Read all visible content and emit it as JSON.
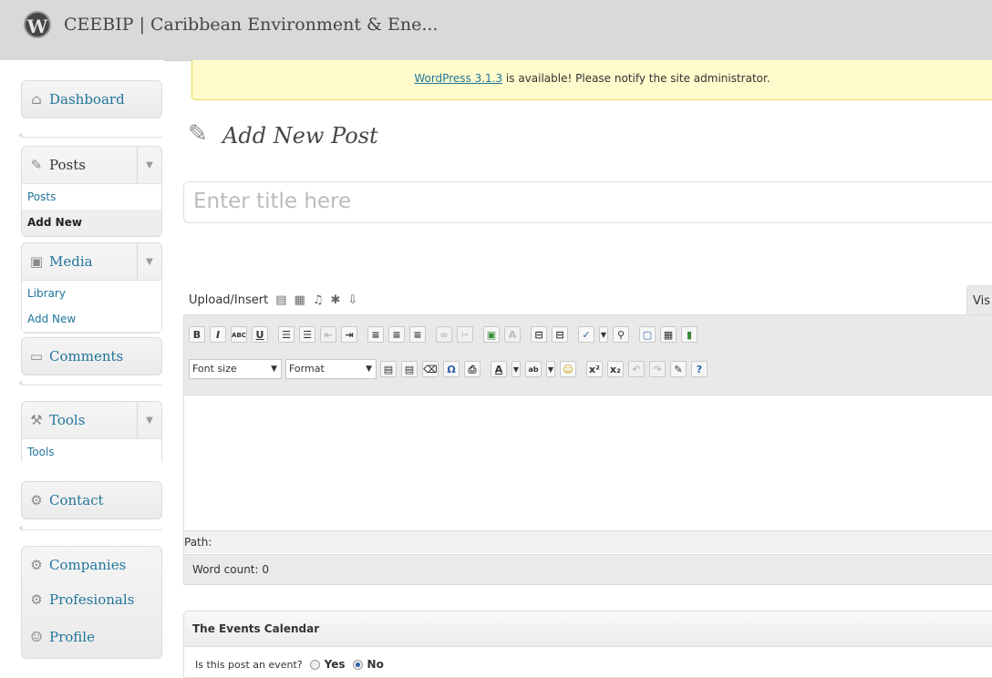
{
  "header": {
    "site_title": "CEEBIP | Caribbean Environment & Ene...",
    "logo_letter": "W"
  },
  "sidebar": {
    "dashboard": "Dashboard",
    "posts": {
      "label": "Posts",
      "items": [
        "Posts",
        "Add New"
      ]
    },
    "media": {
      "label": "Media",
      "items": [
        "Library",
        "Add New"
      ]
    },
    "comments": "Comments",
    "tools": {
      "label": "Tools",
      "items": [
        "Tools"
      ]
    },
    "contact": "Contact",
    "companies": "Companies",
    "profesionals": "Profesionals",
    "profile": "Profile"
  },
  "notice": {
    "link": "WordPress 3.1.3",
    "text": " is available! Please notify the site administrator."
  },
  "page": {
    "title": "Add New Post",
    "title_placeholder": "Enter title here"
  },
  "editor": {
    "upload_label": "Upload/Insert",
    "visual_tab": "Vis",
    "font_size": "Font size",
    "format": "Format",
    "path_label": "Path:",
    "word_count": "Word count: 0"
  },
  "events": {
    "title": "The Events Calendar",
    "question": "Is this post an event?",
    "yes": "Yes",
    "no": "No",
    "selected": "No"
  },
  "colors": {
    "link": "#21759b",
    "notice_bg": "#fffbcc",
    "header_bg": "#d9d9d9"
  }
}
